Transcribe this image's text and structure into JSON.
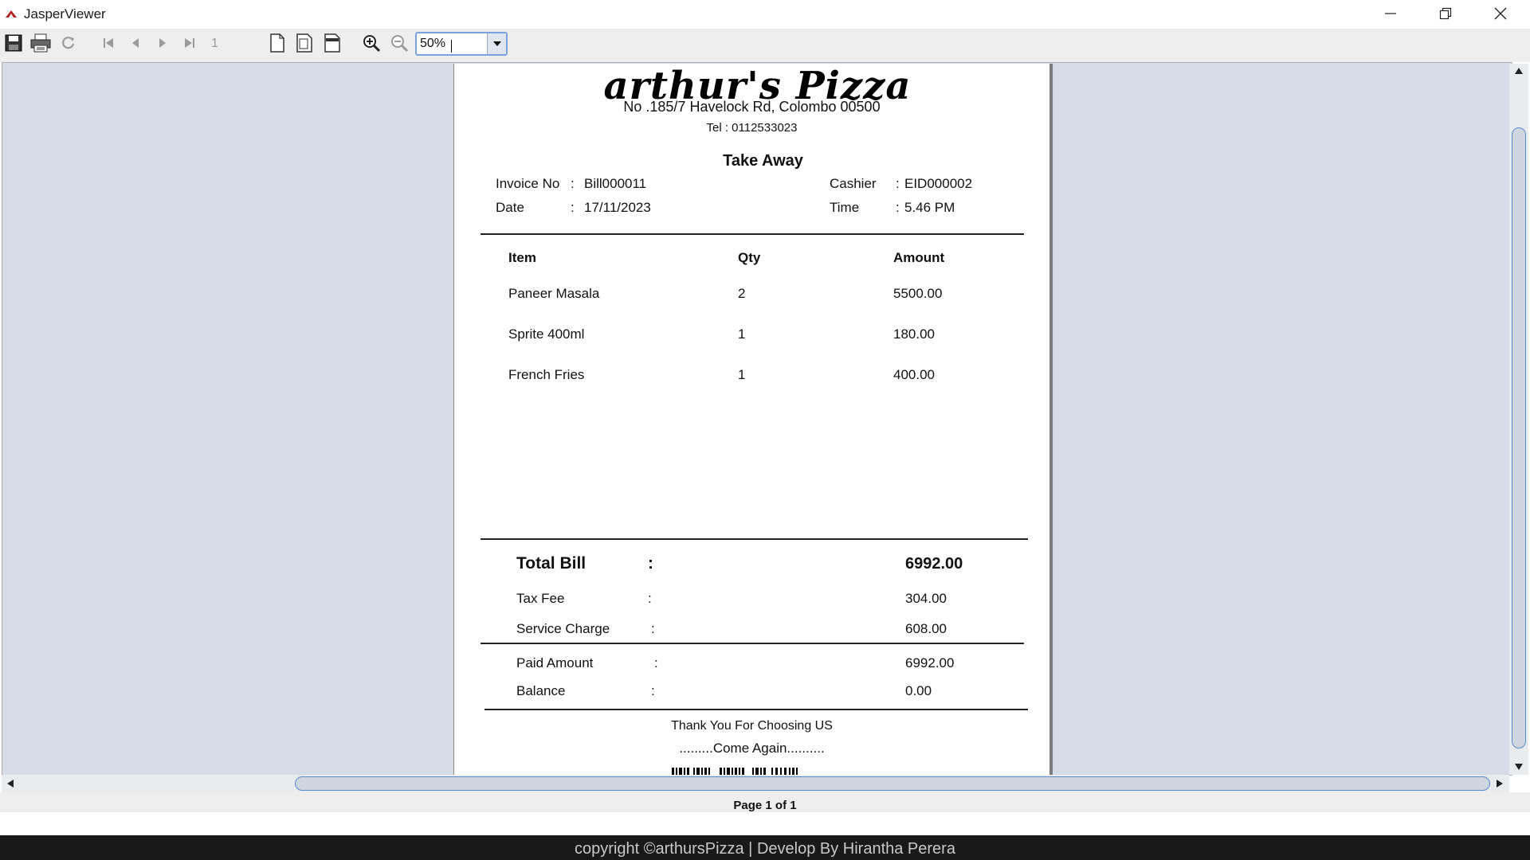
{
  "window": {
    "title": "JasperViewer"
  },
  "toolbar": {
    "buttons": [
      "save-icon",
      "print-icon",
      "reload-icon",
      "first-page-icon",
      "previous-page-icon",
      "next-page-icon",
      "last-page-icon",
      "actual-size-icon",
      "fit-page-icon",
      "fit-width-icon",
      "zoom-in-icon",
      "zoom-out-icon"
    ],
    "page_number": "1",
    "zoom": "50%"
  },
  "report": {
    "logo_text": "arthur's Pizza",
    "address": "No .185/7 Havelock Rd, Colombo 00500",
    "tel": "Tel : 0112533023",
    "order_type": "Take Away",
    "invoice_label": "Invoice No",
    "invoice_colon": ":",
    "invoice_no": "Bill000011",
    "date_label": "Date",
    "date_colon": ":",
    "date": "17/11/2023",
    "cashier_label": "Cashier",
    "cashier_colon": ":",
    "cashier": "EID000002",
    "time_label": "Time",
    "time_colon": ":",
    "time": "5.46 PM",
    "columns": {
      "item": "Item",
      "qty": "Qty",
      "amount": "Amount"
    },
    "items": [
      {
        "name": "Paneer Masala",
        "qty": "2",
        "amount": "5500.00"
      },
      {
        "name": "Sprite 400ml",
        "qty": "1",
        "amount": "180.00"
      },
      {
        "name": "French Fries",
        "qty": "1",
        "amount": "400.00"
      }
    ],
    "totals": {
      "total_label": "Total Bill",
      "total_colon": ":",
      "total": "6992.00",
      "tax_label": "Tax Fee",
      "tax_colon": ":",
      "tax": "304.00",
      "service_label": "Service Charge",
      "service_colon": ":",
      "service": "608.00",
      "paid_label": "Paid Amount",
      "paid_colon": ":",
      "paid": "6992.00",
      "balance_label": "Balance",
      "balance_colon": ":",
      "balance": "0.00"
    },
    "thanks": "Thank You For Choosing US",
    "come_again": ".........Come Again.........."
  },
  "status": {
    "page_label": "Page 1 of 1"
  },
  "footer": {
    "text": "copyright ©arthursPizza | Develop By Hirantha Perera"
  },
  "colors": {
    "viewer_bg": "#d6dce5",
    "scroll_accent": "#5a8bd0",
    "footer_bg": "#191919"
  }
}
